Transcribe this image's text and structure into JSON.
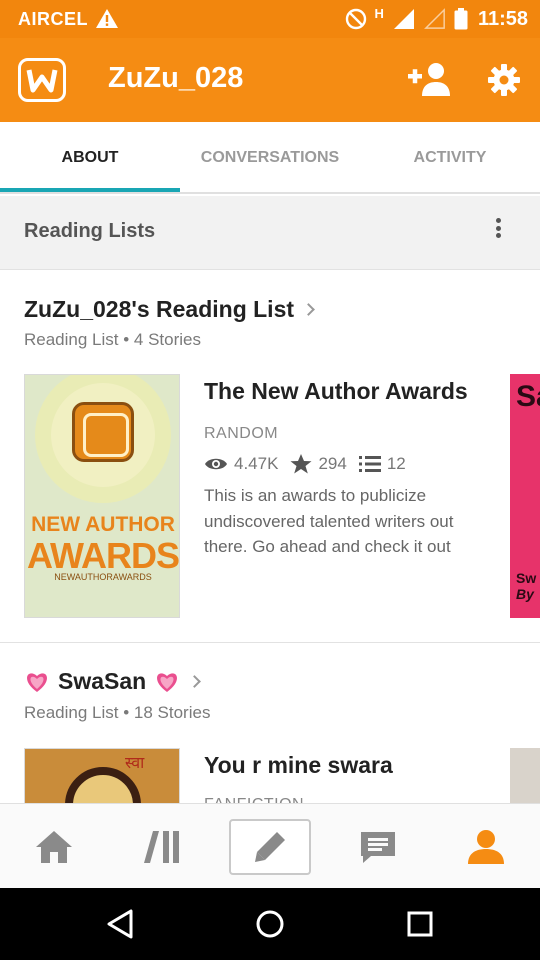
{
  "status_bar": {
    "carrier": "AIRCEL",
    "network_type": "H",
    "time": "11:58"
  },
  "app_bar": {
    "title": "ZuZu_028",
    "icons": [
      "wattpad-logo-icon",
      "add-user-icon",
      "gear-icon"
    ]
  },
  "tabs": [
    {
      "label": "ABOUT",
      "active": true
    },
    {
      "label": "CONVERSATIONS",
      "active": false
    },
    {
      "label": "ACTIVITY",
      "active": false
    }
  ],
  "section": {
    "title": "Reading Lists"
  },
  "reading_lists": [
    {
      "title": "ZuZu_028's Reading List",
      "subtitle": "Reading List • 4 Stories",
      "stories": [
        {
          "cover_text": [
            "NEW AUTHOR",
            "AWARDS",
            "NEWAUTHORAWARDS"
          ],
          "title": "The New Author Awards",
          "category": "RANDOM",
          "reads": "4.47K",
          "votes": "294",
          "parts": "12",
          "description": "This is an awards to publicize undiscovered talented writers out there. Go ahead and check it out"
        }
      ],
      "peek_cover_text": [
        "Sa",
        "Sw",
        "By"
      ]
    },
    {
      "title": "SwaSan",
      "subtitle": "Reading List • 18 Stories",
      "stories": [
        {
          "cover_text": "स्वा",
          "title": "You r mine swara",
          "category": "FANFICTION"
        }
      ]
    }
  ],
  "colors": {
    "brand_orange": "#f58c13",
    "tab_indicator": "#19a6b4",
    "active_nav": "#f58c13"
  },
  "bottom_nav": [
    "home-icon",
    "library-icon",
    "write-icon",
    "messages-icon",
    "profile-icon"
  ],
  "system_nav": [
    "back-icon",
    "home-circle-icon",
    "recents-icon"
  ]
}
